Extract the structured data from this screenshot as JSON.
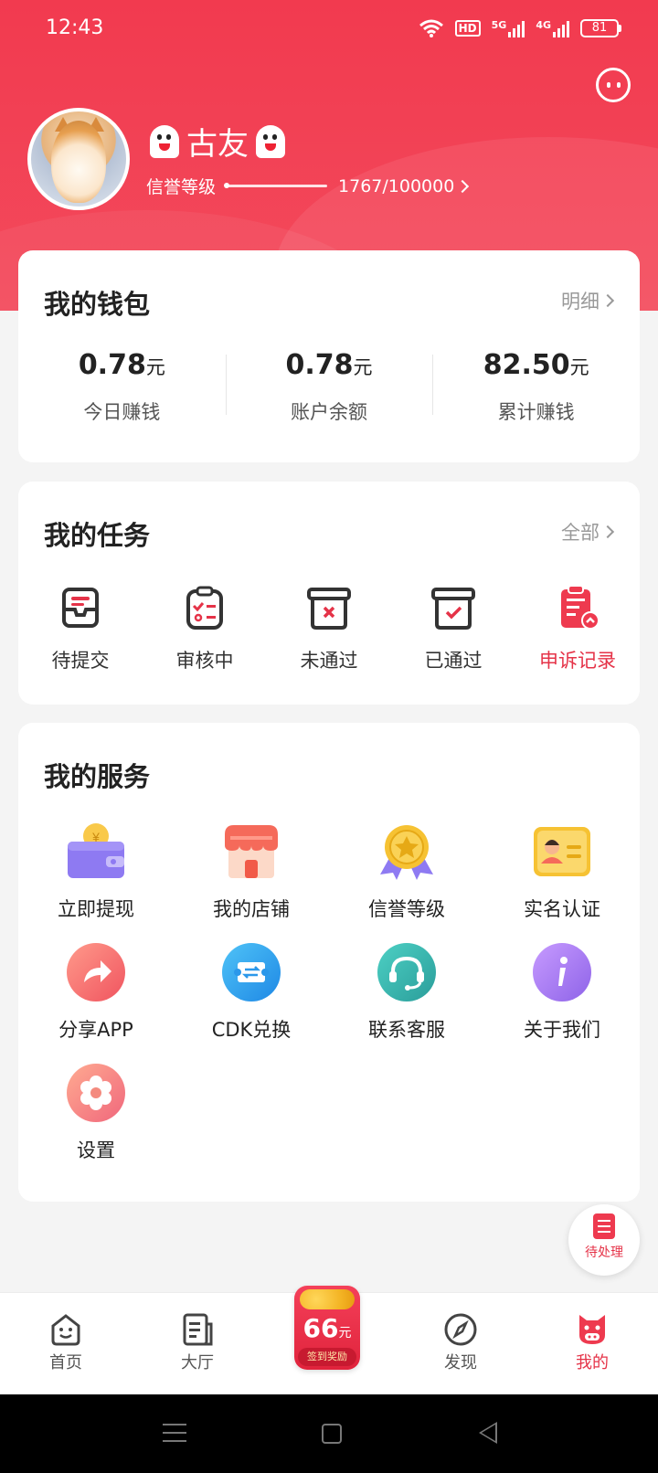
{
  "status_bar": {
    "time": "12:43",
    "hd": "HD",
    "net1": "5G",
    "net2": "4G",
    "battery": "81"
  },
  "profile": {
    "name": "古友",
    "credit_label": "信誉等级",
    "credit_value": "1767/100000",
    "credit_progress": 0.01767
  },
  "wallet": {
    "title": "我的钱包",
    "link": "明细",
    "unit": "元",
    "items": [
      {
        "value": "0.78",
        "label": "今日赚钱"
      },
      {
        "value": "0.78",
        "label": "账户余额"
      },
      {
        "value": "82.50",
        "label": "累计赚钱"
      }
    ]
  },
  "tasks": {
    "title": "我的任务",
    "link": "全部",
    "items": [
      {
        "label": "待提交",
        "icon": "inbox-icon"
      },
      {
        "label": "审核中",
        "icon": "clipboard-check-icon"
      },
      {
        "label": "未通过",
        "icon": "box-x-icon"
      },
      {
        "label": "已通过",
        "icon": "box-check-icon"
      },
      {
        "label": "申诉记录",
        "icon": "appeal-record-icon"
      }
    ]
  },
  "services": {
    "title": "我的服务",
    "items": [
      {
        "label": "立即提现",
        "icon": "wallet-withdraw-icon"
      },
      {
        "label": "我的店铺",
        "icon": "store-icon"
      },
      {
        "label": "信誉等级",
        "icon": "medal-icon"
      },
      {
        "label": "实名认证",
        "icon": "id-card-icon"
      },
      {
        "label": "分享APP",
        "icon": "share-icon"
      },
      {
        "label": "CDK兑换",
        "icon": "ticket-exchange-icon"
      },
      {
        "label": "联系客服",
        "icon": "headset-icon"
      },
      {
        "label": "关于我们",
        "icon": "info-icon"
      },
      {
        "label": "设置",
        "icon": "settings-gear-icon"
      }
    ]
  },
  "pending_fab": {
    "label": "待处理"
  },
  "tabbar": {
    "items": [
      {
        "label": "首页",
        "icon": "smile-home-icon"
      },
      {
        "label": "大厅",
        "icon": "document-hall-icon"
      },
      {
        "label": "",
        "icon": "sign-in-reward-icon"
      },
      {
        "label": "发现",
        "icon": "compass-icon"
      },
      {
        "label": "我的",
        "icon": "piggy-profile-icon"
      }
    ],
    "center": {
      "amount": "66",
      "unit": "元",
      "caption": "签到奖励"
    }
  },
  "colors": {
    "brand": "#f23a4f",
    "accent_text": "#e53348"
  }
}
